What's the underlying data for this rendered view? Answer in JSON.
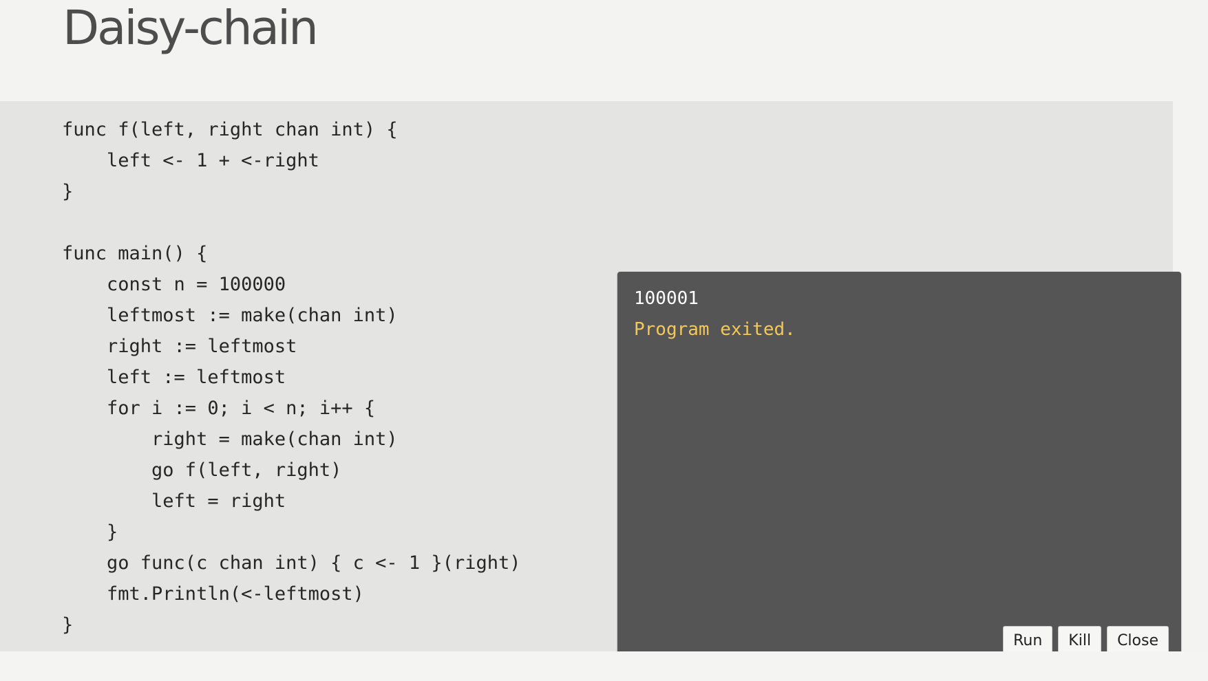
{
  "slide": {
    "title": "Daisy-chain"
  },
  "code": {
    "lines": [
      "func f(left, right chan int) {",
      "    left <- 1 + <-right",
      "}",
      "",
      "func main() {",
      "    const n = 100000",
      "    leftmost := make(chan int)",
      "    right := leftmost",
      "    left := leftmost",
      "    for i := 0; i < n; i++ {",
      "        right = make(chan int)",
      "        go f(left, right)",
      "        left = right",
      "    }",
      "    go func(c chan int) { c <- 1 }(right)",
      "    fmt.Println(<-leftmost)",
      "}"
    ]
  },
  "output": {
    "stdout": "100001",
    "system": "Program exited.",
    "colors": {
      "background": "#555555",
      "stdout": "#ffffff",
      "system": "#f2c85b"
    }
  },
  "buttons": {
    "run": "Run",
    "kill": "Kill",
    "close": "Close"
  }
}
